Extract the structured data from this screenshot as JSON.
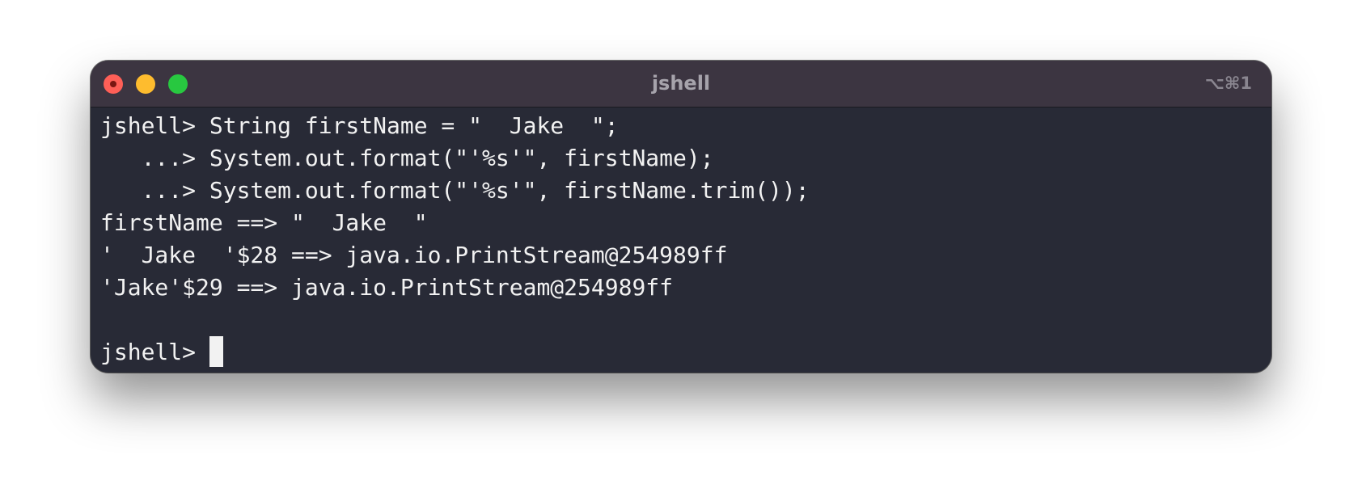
{
  "window": {
    "title": "jshell",
    "shortcut": "⌥⌘1"
  },
  "terminal": {
    "lines": [
      "jshell> String firstName = \"  Jake  \";",
      "   ...> System.out.format(\"'%s'\", firstName);",
      "   ...> System.out.format(\"'%s'\", firstName.trim());",
      "firstName ==> \"  Jake  \"",
      "'  Jake  '$28 ==> java.io.PrintStream@254989ff",
      "'Jake'$29 ==> java.io.PrintStream@254989ff",
      ""
    ],
    "prompt": "jshell> "
  },
  "colors": {
    "background": "#282a36",
    "titlebar": "#3c3541",
    "text": "#f2f2f2",
    "close": "#fe5f57",
    "minimize": "#febc2e",
    "zoom": "#28c840"
  }
}
